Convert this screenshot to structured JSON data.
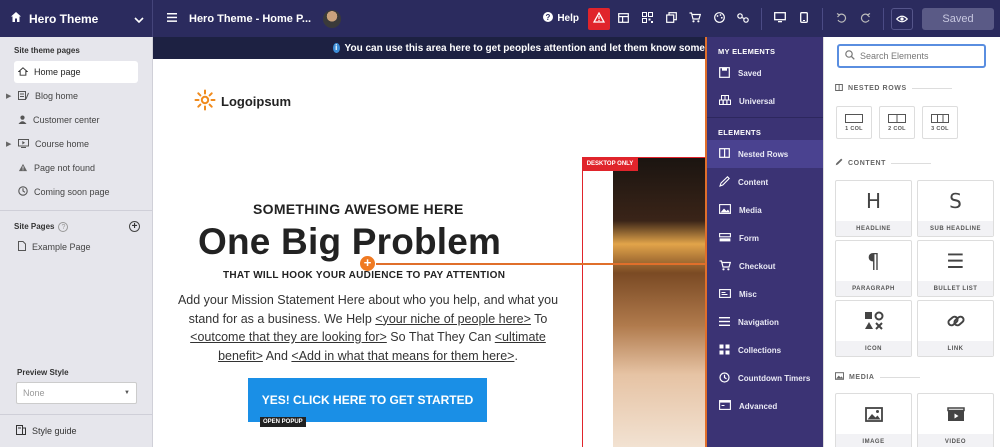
{
  "topbar": {
    "theme_name": "Hero Theme",
    "page_title": "Hero Theme - Home P...",
    "help_label": "Help",
    "saved_label": "Saved"
  },
  "sidebar": {
    "section_title": "Site theme pages",
    "theme_pages": [
      {
        "label": "Home page",
        "icon": "home-icon"
      },
      {
        "label": "Blog home",
        "icon": "blog-icon"
      },
      {
        "label": "Customer center",
        "icon": "user-icon"
      },
      {
        "label": "Course home",
        "icon": "course-icon"
      },
      {
        "label": "Page not found",
        "icon": "warning-icon"
      },
      {
        "label": "Coming soon page",
        "icon": "clock-icon"
      }
    ],
    "site_pages_title": "Site Pages",
    "site_pages": [
      {
        "label": "Example Page",
        "icon": "page-icon"
      }
    ],
    "preview_style_label": "Preview Style",
    "preview_style_value": "None",
    "style_guide_label": "Style guide"
  },
  "canvas": {
    "announcement": "You can use this area here to get peoples attention and let them know some",
    "logo_text": "Logoipsum",
    "desktop_only_label": "DESKTOP ONLY",
    "headline_small": "SOMETHING AWESOME HERE",
    "headline_big": "One Big Problem",
    "headline_hook": "THAT WILL HOOK YOUR AUDIENCE TO PAY ATTENTION",
    "mission_1": "Add your Mission Statement Here about who you help, and what you stand for as a business. We Help ",
    "mission_link_1": "<your niche of people here>",
    "mission_2": " To ",
    "mission_link_2": "<outcome that they are looking for>",
    "mission_3": " So That They Can ",
    "mission_link_3": "<ultimate benefit>",
    "mission_4": " And ",
    "mission_link_4": "<Add in what that means for them here>",
    "mission_5": ".",
    "cta_label": "YES! CLICK HERE TO GET STARTED",
    "open_popup_label": "OPEN POPUP"
  },
  "elements_nav": {
    "my_elements_title": "MY ELEMENTS",
    "my_items": [
      {
        "label": "Saved",
        "icon": "saved-icon"
      },
      {
        "label": "Universal",
        "icon": "universal-icon"
      }
    ],
    "elements_title": "ELEMENTS",
    "items": [
      {
        "label": "Nested Rows",
        "icon": "nested-rows-icon"
      },
      {
        "label": "Content",
        "icon": "content-icon"
      },
      {
        "label": "Media",
        "icon": "media-icon"
      },
      {
        "label": "Form",
        "icon": "form-icon"
      },
      {
        "label": "Checkout",
        "icon": "checkout-icon"
      },
      {
        "label": "Misc",
        "icon": "misc-icon"
      },
      {
        "label": "Navigation",
        "icon": "navigation-icon"
      },
      {
        "label": "Collections",
        "icon": "collections-icon"
      },
      {
        "label": "Countdown Timers",
        "icon": "countdown-icon"
      },
      {
        "label": "Advanced",
        "icon": "advanced-icon"
      }
    ]
  },
  "elements_panel": {
    "search_placeholder": "Search Elements",
    "nested_rows_title": "NESTED ROWS",
    "rows": [
      "1 COL",
      "2 COL",
      "3 COL"
    ],
    "content_title": "CONTENT",
    "content_items": [
      {
        "label": "HEADLINE",
        "icon": "H"
      },
      {
        "label": "SUB HEADLINE",
        "icon": "S"
      },
      {
        "label": "PARAGRAPH",
        "icon": "¶"
      },
      {
        "label": "BULLET LIST",
        "icon": "☰"
      },
      {
        "label": "ICON",
        "icon": "icon-icon"
      },
      {
        "label": "LINK",
        "icon": "link-icon"
      }
    ],
    "media_title": "MEDIA",
    "media_items": [
      {
        "label": "IMAGE",
        "icon": "image-icon"
      },
      {
        "label": "VIDEO",
        "icon": "video-icon"
      }
    ]
  },
  "colors": {
    "topbar_bg": "#2b2b5e",
    "nav_bg": "#3b3374",
    "accent_red": "#e0242b",
    "accent_orange": "#e06f2b",
    "cta_blue": "#1a8fe6"
  }
}
